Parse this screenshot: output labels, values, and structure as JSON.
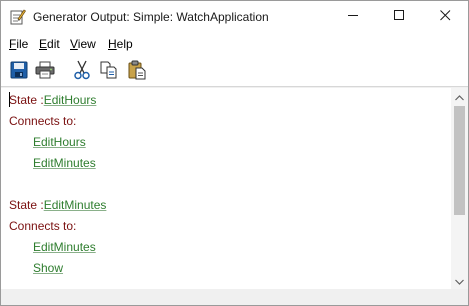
{
  "window": {
    "title": "Generator Output: Simple: WatchApplication",
    "icons": {
      "app": "notepad-pencil-icon",
      "minimize": "minimize-icon",
      "maximize": "maximize-icon",
      "close": "close-icon"
    }
  },
  "menu": {
    "file": {
      "accel": "F",
      "rest": "ile"
    },
    "edit": {
      "accel": "E",
      "rest": "dit"
    },
    "view": {
      "accel": "V",
      "rest": "iew"
    },
    "help": {
      "accel": "H",
      "rest": "elp"
    }
  },
  "toolbar": {
    "buttons": [
      "save-icon",
      "print-icon",
      "cut-icon",
      "copy-icon",
      "paste-icon"
    ]
  },
  "output": {
    "block1": {
      "state_prefix": "State :",
      "state_name": "EditHours",
      "connects_label": "Connects to:",
      "targets": [
        "EditHours",
        "EditMinutes"
      ]
    },
    "block2": {
      "state_prefix": "State :",
      "state_name": "EditMinutes",
      "connects_label": "Connects to:",
      "targets": [
        "EditMinutes",
        "Show"
      ]
    }
  },
  "colors": {
    "keyword": "#7a1010",
    "link": "#2e7d2e"
  }
}
